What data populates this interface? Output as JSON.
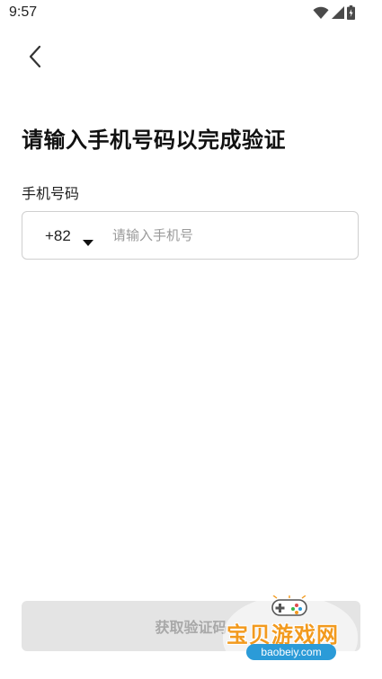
{
  "status_bar": {
    "time": "9:57"
  },
  "page": {
    "title": "请输入手机号码以完成验证",
    "phone_label": "手机号码",
    "country_code": "+82",
    "phone_placeholder": "请输入手机号",
    "phone_value": "",
    "get_code_label": "获取验证码"
  },
  "watermark": {
    "title": "宝贝游戏网",
    "url": "baobeiy.com"
  },
  "colors": {
    "button_disabled_bg": "#e4e4e4",
    "button_disabled_text": "#a8a8a8",
    "watermark_orange": "#f29a1e",
    "watermark_blue": "#2b9bd8"
  },
  "icons": [
    "wifi-icon",
    "signal-icon",
    "battery-icon",
    "back-arrow-icon",
    "caret-down-icon",
    "gamepad-icon"
  ]
}
